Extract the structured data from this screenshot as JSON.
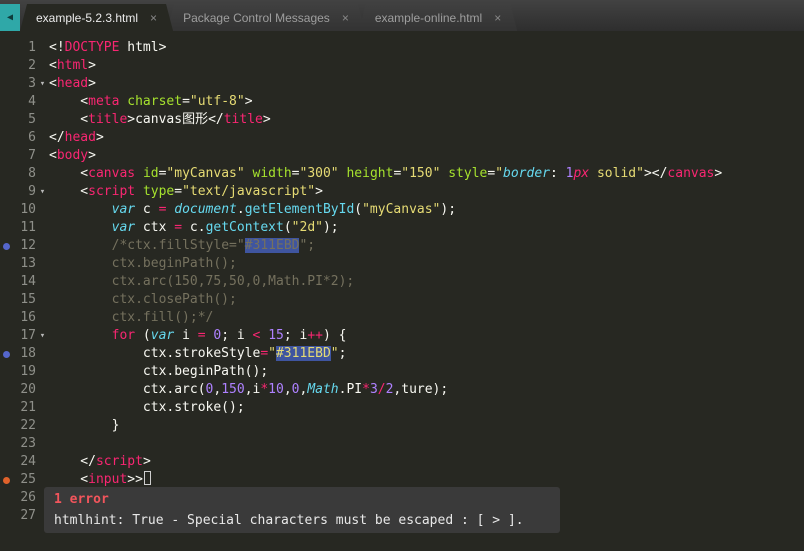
{
  "tab_bar": {
    "scroll_left_glyph": "◀",
    "close_glyph": "×",
    "tabs": [
      {
        "label": "example-5.2.3.html",
        "active": true
      },
      {
        "label": "Package Control Messages",
        "active": false
      },
      {
        "label": "example-online.html",
        "active": false
      }
    ]
  },
  "editor": {
    "fold_glyph": "▾",
    "lines": [
      {
        "num": 1,
        "tokens": [
          [
            "p",
            "<!"
          ],
          [
            "t",
            "DOCTYPE"
          ],
          [
            "p",
            " html>"
          ]
        ]
      },
      {
        "num": 2,
        "tokens": [
          [
            "p",
            "<"
          ],
          [
            "t",
            "html"
          ],
          [
            "p",
            ">"
          ]
        ]
      },
      {
        "num": 3,
        "fold": true,
        "tokens": [
          [
            "p",
            "<"
          ],
          [
            "t",
            "head"
          ],
          [
            "p",
            ">"
          ]
        ]
      },
      {
        "num": 4,
        "tokens": [
          [
            "p",
            "    <"
          ],
          [
            "t",
            "meta"
          ],
          [
            "p",
            " "
          ],
          [
            "a",
            "charset"
          ],
          [
            "p",
            "="
          ],
          [
            "s",
            "\"utf-8\""
          ],
          [
            "p",
            ">"
          ]
        ]
      },
      {
        "num": 5,
        "tokens": [
          [
            "p",
            "    <"
          ],
          [
            "t",
            "title"
          ],
          [
            "p",
            ">canvas图形</"
          ],
          [
            "t",
            "title"
          ],
          [
            "p",
            ">"
          ]
        ]
      },
      {
        "num": 6,
        "tokens": [
          [
            "p",
            "</"
          ],
          [
            "t",
            "head"
          ],
          [
            "p",
            ">"
          ]
        ]
      },
      {
        "num": 7,
        "tokens": [
          [
            "p",
            "<"
          ],
          [
            "t",
            "body"
          ],
          [
            "p",
            ">"
          ]
        ]
      },
      {
        "num": 8,
        "tokens": [
          [
            "p",
            "    <"
          ],
          [
            "t",
            "canvas"
          ],
          [
            "p",
            " "
          ],
          [
            "a",
            "id"
          ],
          [
            "p",
            "="
          ],
          [
            "s",
            "\"myCanvas\""
          ],
          [
            "p",
            " "
          ],
          [
            "a",
            "width"
          ],
          [
            "p",
            "="
          ],
          [
            "s",
            "\"300\""
          ],
          [
            "p",
            " "
          ],
          [
            "a",
            "height"
          ],
          [
            "p",
            "="
          ],
          [
            "s",
            "\"150\""
          ],
          [
            "p",
            " "
          ],
          [
            "a",
            "style"
          ],
          [
            "p",
            "="
          ],
          [
            "s",
            "\""
          ],
          [
            "bi",
            "border"
          ],
          [
            "p",
            ": "
          ],
          [
            "n",
            "1"
          ],
          [
            "ki",
            "px"
          ],
          [
            "p",
            " "
          ],
          [
            "s",
            "solid\""
          ],
          [
            "p",
            "></"
          ],
          [
            "t",
            "canvas"
          ],
          [
            "p",
            ">"
          ]
        ]
      },
      {
        "num": 9,
        "fold": true,
        "tokens": [
          [
            "p",
            "    <"
          ],
          [
            "t",
            "script"
          ],
          [
            "p",
            " "
          ],
          [
            "a",
            "type"
          ],
          [
            "p",
            "="
          ],
          [
            "s",
            "\"text/javascript\""
          ],
          [
            "p",
            ">"
          ]
        ]
      },
      {
        "num": 10,
        "tokens": [
          [
            "p",
            "        "
          ],
          [
            "bi",
            "var"
          ],
          [
            "p",
            " c "
          ],
          [
            "k",
            "="
          ],
          [
            "p",
            " "
          ],
          [
            "bi",
            "document"
          ],
          [
            "p",
            "."
          ],
          [
            "b",
            "getElementById"
          ],
          [
            "p",
            "("
          ],
          [
            "s",
            "\"myCanvas\""
          ],
          [
            "p",
            ");"
          ]
        ]
      },
      {
        "num": 11,
        "tokens": [
          [
            "p",
            "        "
          ],
          [
            "bi",
            "var"
          ],
          [
            "p",
            " ctx "
          ],
          [
            "k",
            "="
          ],
          [
            "p",
            " c."
          ],
          [
            "b",
            "getContext"
          ],
          [
            "p",
            "("
          ],
          [
            "s",
            "\"2d\""
          ],
          [
            "p",
            ");"
          ]
        ]
      },
      {
        "num": 12,
        "marker": "bookmark",
        "tokens": [
          [
            "p",
            "        "
          ],
          [
            "c",
            "/*ctx.fillStyle=\""
          ],
          [
            "c hl",
            "#311EBD"
          ],
          [
            "c",
            "\";"
          ]
        ]
      },
      {
        "num": 13,
        "tokens": [
          [
            "c",
            "        ctx.beginPath();"
          ]
        ]
      },
      {
        "num": 14,
        "tokens": [
          [
            "c",
            "        ctx.arc(150,75,50,0,Math.PI*2);"
          ]
        ]
      },
      {
        "num": 15,
        "tokens": [
          [
            "c",
            "        ctx.closePath();"
          ]
        ]
      },
      {
        "num": 16,
        "tokens": [
          [
            "c",
            "        ctx.fill();*/"
          ]
        ]
      },
      {
        "num": 17,
        "fold": true,
        "tokens": [
          [
            "p",
            "        "
          ],
          [
            "k",
            "for"
          ],
          [
            "p",
            " ("
          ],
          [
            "bi",
            "var"
          ],
          [
            "p",
            " i "
          ],
          [
            "k",
            "="
          ],
          [
            "p",
            " "
          ],
          [
            "n",
            "0"
          ],
          [
            "p",
            "; i "
          ],
          [
            "k",
            "<"
          ],
          [
            "p",
            " "
          ],
          [
            "n",
            "15"
          ],
          [
            "p",
            "; i"
          ],
          [
            "k",
            "++"
          ],
          [
            "p",
            ") {"
          ]
        ]
      },
      {
        "num": 18,
        "marker": "bookmark",
        "tokens": [
          [
            "p",
            "            ctx.strokeStyle"
          ],
          [
            "k",
            "="
          ],
          [
            "s",
            "\""
          ],
          [
            "s hl",
            "#311EBD"
          ],
          [
            "s",
            "\""
          ],
          [
            "p",
            ";"
          ]
        ]
      },
      {
        "num": 19,
        "tokens": [
          [
            "p",
            "            ctx.beginPath();"
          ]
        ]
      },
      {
        "num": 20,
        "tokens": [
          [
            "p",
            "            ctx.arc("
          ],
          [
            "n",
            "0"
          ],
          [
            "p",
            ","
          ],
          [
            "n",
            "150"
          ],
          [
            "p",
            ",i"
          ],
          [
            "k",
            "*"
          ],
          [
            "n",
            "10"
          ],
          [
            "p",
            ","
          ],
          [
            "n",
            "0"
          ],
          [
            "p",
            ","
          ],
          [
            "bi",
            "Math"
          ],
          [
            "p",
            ".PI"
          ],
          [
            "k",
            "*"
          ],
          [
            "n",
            "3"
          ],
          [
            "k",
            "/"
          ],
          [
            "n",
            "2"
          ],
          [
            "p",
            ",ture);"
          ]
        ]
      },
      {
        "num": 21,
        "tokens": [
          [
            "p",
            "            ctx.stroke();"
          ]
        ]
      },
      {
        "num": 22,
        "tokens": [
          [
            "p",
            "        }"
          ]
        ]
      },
      {
        "num": 23,
        "tokens": []
      },
      {
        "num": 24,
        "tokens": [
          [
            "p",
            "    </"
          ],
          [
            "t",
            "script"
          ],
          [
            "p",
            ">"
          ]
        ]
      },
      {
        "num": 25,
        "marker": "error",
        "caret": true,
        "tokens": [
          [
            "p",
            "    <"
          ],
          [
            "t",
            "input"
          ],
          [
            "p",
            ">>"
          ]
        ]
      },
      {
        "num": 26,
        "tokens": []
      },
      {
        "num": 27,
        "tokens": []
      }
    ]
  },
  "lint_panel": {
    "title": "1 error",
    "message": "htmlhint: True - Special characters must be escaped : [ > ]."
  },
  "colors": {
    "editor-bg": "#272822",
    "tab-active-bg": "#272822",
    "tab-inactive-text": "#9e9e9e",
    "tab-active-text": "#ebebeb",
    "gutter-text": "#8f908a",
    "plain": "#f8f8f2",
    "tag": "#f92672",
    "keyword": "#f92672",
    "attr": "#a6e22e",
    "string": "#e6db74",
    "number": "#ae81ff",
    "comment": "#75715e",
    "support": "#66d9ef",
    "highlight-bg": "#3f55a0",
    "bookmark-dot": "#5566cc",
    "error-dot": "#e0622b",
    "panel-bg": "#3a3a3a",
    "error-text": "#f2555c",
    "panel-text": "#e8e8e8",
    "teal-button": "#2fa8a8"
  }
}
